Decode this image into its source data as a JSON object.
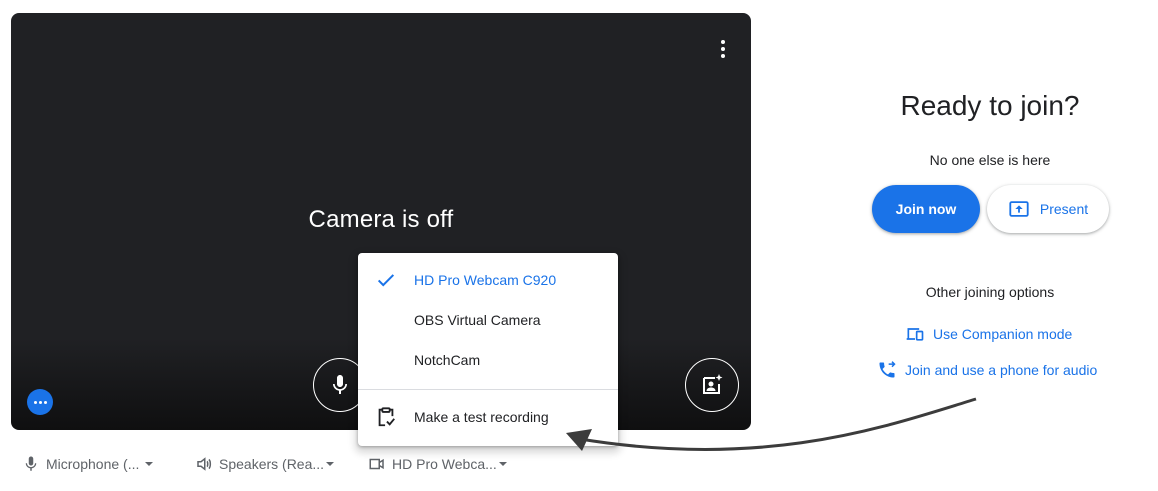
{
  "preview": {
    "camera_status": "Camera is off",
    "options_icon": "more-vert-icon",
    "mic_icon": "microphone-icon",
    "effects_icon": "visual-effects-icon",
    "more_icon": "more-horiz-icon"
  },
  "devices": {
    "microphone": {
      "label": "Microphone (...",
      "icon": "microphone-icon"
    },
    "speakers": {
      "label": "Speakers (Rea...",
      "icon": "speaker-icon"
    },
    "camera": {
      "label": "HD Pro Webca...",
      "icon": "videocam-icon"
    }
  },
  "camera_menu": {
    "items": [
      {
        "label": "HD Pro Webcam C920",
        "selected": true,
        "icon": "check-icon"
      },
      {
        "label": "OBS Virtual Camera",
        "selected": false
      },
      {
        "label": "NotchCam",
        "selected": false
      }
    ],
    "test_recording": {
      "label": "Make a test recording",
      "icon": "clipboard-check-icon"
    }
  },
  "join_panel": {
    "title": "Ready to join?",
    "subtitle": "No one else is here",
    "join_button": "Join now",
    "present_button": "Present",
    "other_options_heading": "Other joining options",
    "companion_link": "Use Companion mode",
    "phone_link": "Join and use a phone for audio"
  },
  "colors": {
    "accent": "#1a73e8",
    "tile_background": "#202124",
    "secondary_text": "#5f6368"
  }
}
